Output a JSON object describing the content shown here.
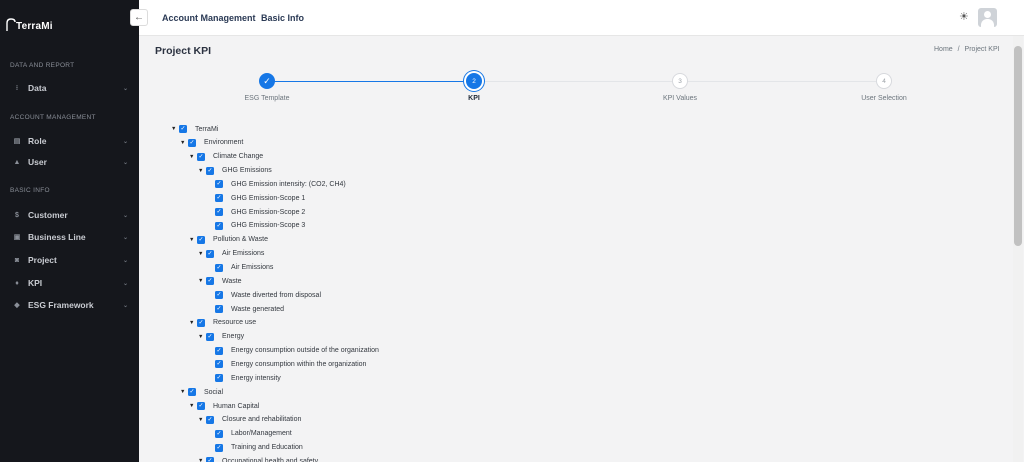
{
  "brand": {
    "name": "TerraMi"
  },
  "sidebar": {
    "sections": [
      {
        "title": "DATA AND REPORT",
        "items": [
          {
            "label": "Data",
            "icon": "data-icon"
          }
        ]
      },
      {
        "title": "ACCOUNT MANAGEMENT",
        "items": [
          {
            "label": "Role",
            "icon": "role-icon"
          },
          {
            "label": "User",
            "icon": "user-icon"
          }
        ]
      },
      {
        "title": "BASIC INFO",
        "items": [
          {
            "label": "Customer",
            "icon": "customer-icon"
          },
          {
            "label": "Business Line",
            "icon": "business-line-icon"
          },
          {
            "label": "Project",
            "icon": "project-icon"
          },
          {
            "label": "KPI",
            "icon": "kpi-icon"
          },
          {
            "label": "ESG Framework",
            "icon": "esg-framework-icon"
          }
        ]
      }
    ]
  },
  "topbar": {
    "links": [
      "Account Management",
      "Basic Info"
    ]
  },
  "page": {
    "title": "Project KPI",
    "breadcrumb": {
      "home": "Home",
      "separator": "/",
      "current": "Project KPI"
    }
  },
  "stepper": {
    "steps": [
      {
        "number": "1",
        "label": "ESG Template",
        "state": "done"
      },
      {
        "number": "2",
        "label": "KPI",
        "state": "active"
      },
      {
        "number": "3",
        "label": "KPI Values",
        "state": "pending"
      },
      {
        "number": "4",
        "label": "User Selection",
        "state": "pending"
      }
    ]
  },
  "tree": [
    {
      "label": "TerraMi",
      "level": 0,
      "expanded": true,
      "checked": true
    },
    {
      "label": "Environment",
      "level": 1,
      "expanded": true,
      "checked": true
    },
    {
      "label": "Climate Change",
      "level": 2,
      "expanded": true,
      "checked": true
    },
    {
      "label": "GHG Emissions",
      "level": 3,
      "expanded": true,
      "checked": true
    },
    {
      "label": "GHG Emission intensity: (CO2, CH4)",
      "level": 4,
      "checked": true
    },
    {
      "label": "GHG Emission-Scope 1",
      "level": 4,
      "checked": true
    },
    {
      "label": "GHG Emission-Scope 2",
      "level": 4,
      "checked": true
    },
    {
      "label": "GHG Emission-Scope 3",
      "level": 4,
      "checked": true
    },
    {
      "label": "Pollution & Waste",
      "level": 2,
      "expanded": true,
      "checked": true
    },
    {
      "label": "Air Emissions",
      "level": 3,
      "expanded": true,
      "checked": true
    },
    {
      "label": "Air Emissions",
      "level": 4,
      "checked": true
    },
    {
      "label": "Waste",
      "level": 3,
      "expanded": true,
      "checked": true
    },
    {
      "label": "Waste diverted from disposal",
      "level": 4,
      "checked": true
    },
    {
      "label": "Waste generated",
      "level": 4,
      "checked": true
    },
    {
      "label": "Resource use",
      "level": 2,
      "expanded": true,
      "checked": true
    },
    {
      "label": "Energy",
      "level": 3,
      "expanded": true,
      "checked": true
    },
    {
      "label": "Energy consumption outside of the organization",
      "level": 4,
      "checked": true
    },
    {
      "label": "Energy consumption within the organization",
      "level": 4,
      "checked": true
    },
    {
      "label": "Energy intensity",
      "level": 4,
      "checked": true
    },
    {
      "label": "Social",
      "level": 1,
      "expanded": true,
      "checked": true
    },
    {
      "label": "Human Capital",
      "level": 2,
      "expanded": true,
      "checked": true
    },
    {
      "label": "Closure and rehabilitation",
      "level": 3,
      "expanded": true,
      "checked": true
    },
    {
      "label": "Labor/Management",
      "level": 4,
      "checked": true
    },
    {
      "label": "Training and Education",
      "level": 4,
      "checked": true
    },
    {
      "label": "Occupational health and safety",
      "level": 3,
      "expanded": true,
      "checked": true
    }
  ],
  "colors": {
    "accent": "#1677e6",
    "sidebar_bg": "#15171c"
  }
}
